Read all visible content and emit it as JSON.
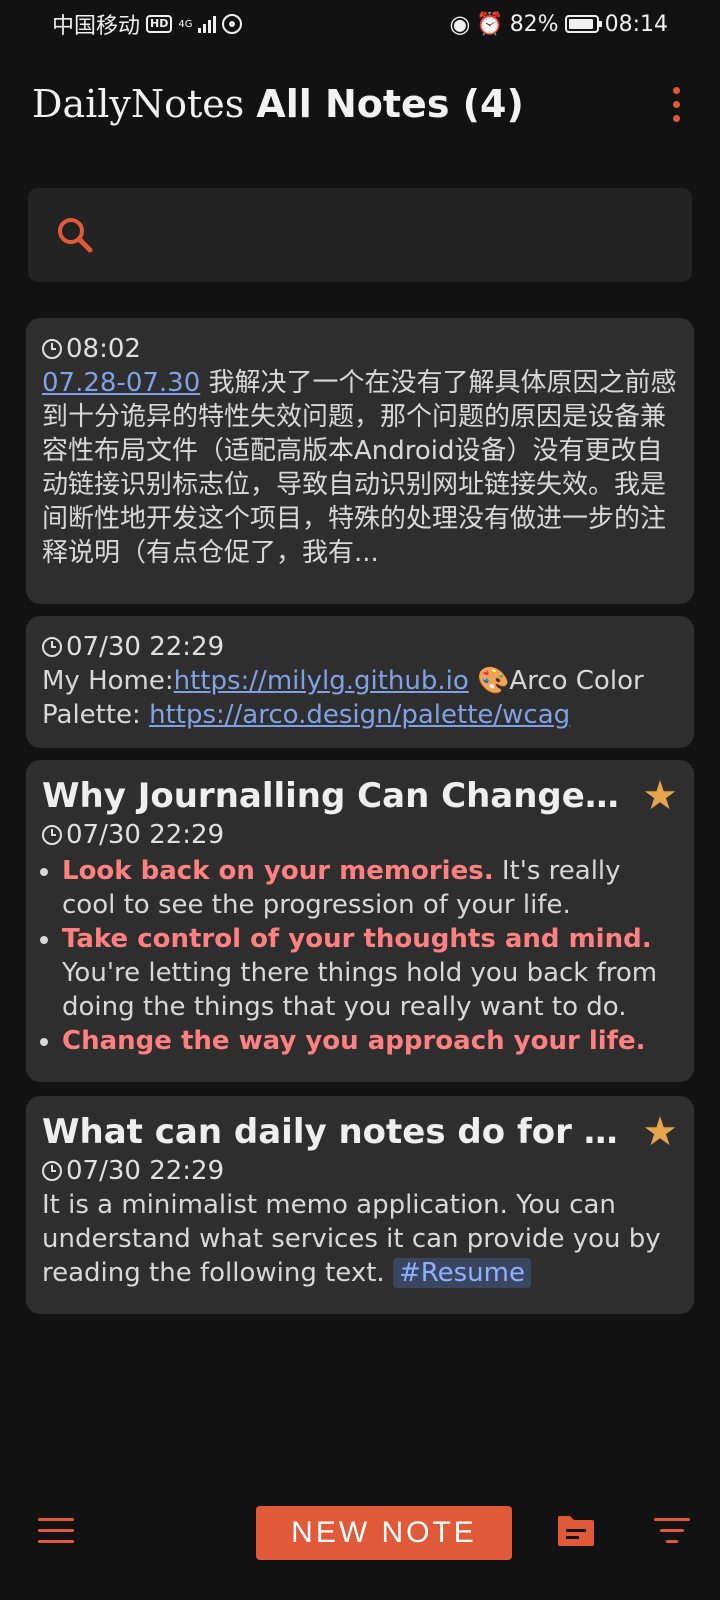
{
  "status": {
    "carrier": "中国移动",
    "hd": "HD",
    "network": "4G",
    "battery": "82%",
    "time": "08:14"
  },
  "header": {
    "brand": "DailyNotes",
    "page_title": "All Notes (4)"
  },
  "search": {
    "placeholder": ""
  },
  "notes": [
    {
      "time": "08:02",
      "link_text": "07.28-07.30",
      "text": "我解决了一个在没有了解具体原因之前感到十分诡异的特性失效问题，那个问题的原因是设备兼容性布局文件（适配高版本Android设备）没有更改自动链接识别标志位，导致自动识别网址链接失效。我是间断性地开发这个项目，特殊的处理没有做进一步的注释说明（有点仓促了，我有..."
    },
    {
      "time": "07/30 22:29",
      "home_label": "My Home:",
      "home_url": "https://milylg.github.io",
      "palette_emoji": "🎨",
      "palette_label": "Arco Color Palette: ",
      "palette_url": "https://arco.design/palette/wcag"
    },
    {
      "title": "Why Journalling Can Change Y...",
      "starred": true,
      "time": "07/30 22:29",
      "points": [
        {
          "bold": "Look back on your memories.",
          "rest": " It's really cool to see the progression of your life."
        },
        {
          "bold": "Take control of your thoughts and mind.",
          "rest": " You're letting there things hold you back from doing the things that you really want to do."
        },
        {
          "bold": "Change the way you approach your life.",
          "rest": ""
        }
      ]
    },
    {
      "title": "What can daily notes do for you?",
      "starred": true,
      "time": "07/30 22:29",
      "text": "It is a minimalist memo application. You can understand what services it can provide you by reading the following text. ",
      "tag": "#Resume"
    }
  ],
  "bottom": {
    "new_note_label": "NEW NOTE"
  },
  "colors": {
    "accent": "#e05a3a",
    "highlight": "#ff8080",
    "link": "#7fa2e6",
    "star": "#e6a44b",
    "card": "#2e2e2e",
    "background": "#121212"
  },
  "icons": {
    "star": "★"
  }
}
